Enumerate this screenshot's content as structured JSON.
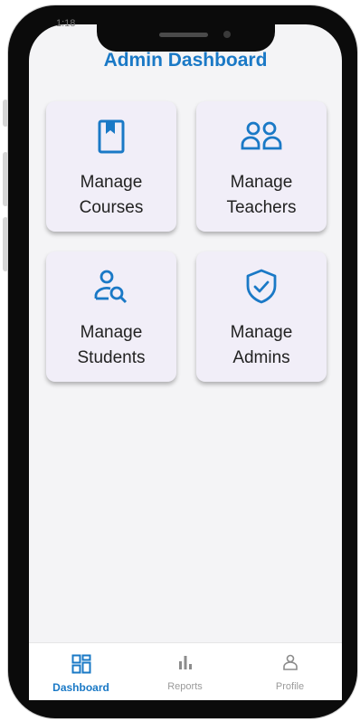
{
  "status_bar": {
    "time": "1:18"
  },
  "header": {
    "title": "Admin Dashboard"
  },
  "cards": [
    {
      "line1": "Manage",
      "line2": "Courses",
      "icon": "book-icon"
    },
    {
      "line1": "Manage",
      "line2": "Teachers",
      "icon": "people-icon"
    },
    {
      "line1": "Manage",
      "line2": "Students",
      "icon": "person-search-icon"
    },
    {
      "line1": "Manage",
      "line2": "Admins",
      "icon": "shield-check-icon"
    }
  ],
  "bottom_nav": [
    {
      "label": "Dashboard",
      "icon": "dashboard-icon",
      "active": true
    },
    {
      "label": "Reports",
      "icon": "bar-chart-icon",
      "active": false
    },
    {
      "label": "Profile",
      "icon": "person-icon",
      "active": false
    }
  ],
  "colors": {
    "accent": "#1a79c6",
    "card_bg": "#f1eef8",
    "screen_bg": "#f4f4f6"
  }
}
